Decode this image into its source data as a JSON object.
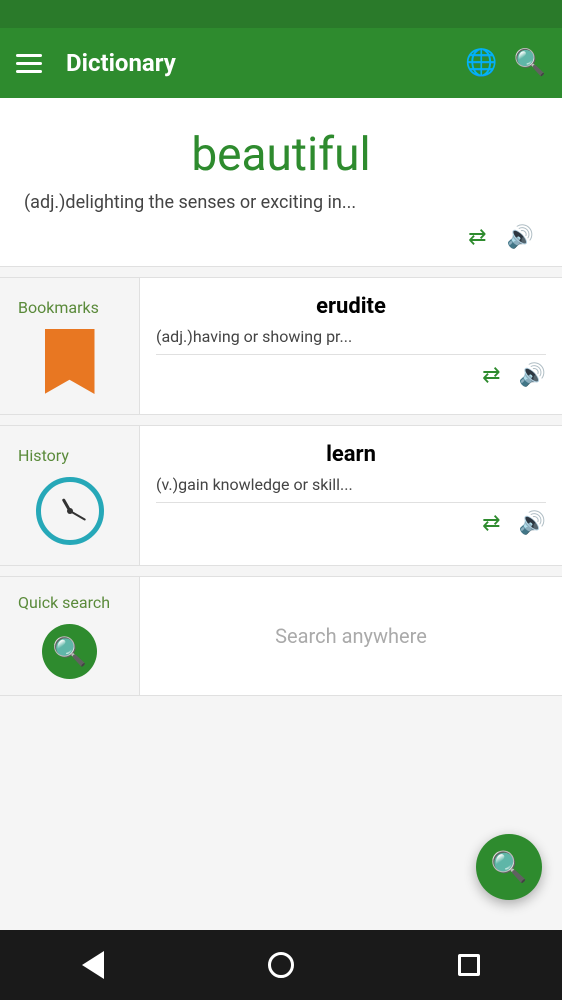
{
  "statusBar": {},
  "toolbar": {
    "title": "Dictionary",
    "menuIcon": "menu-icon",
    "globeIcon": "🌐",
    "searchIcon": "🔍"
  },
  "mainWord": {
    "word": "beautiful",
    "definition": "(adj.)delighting the senses or exciting in..."
  },
  "bookmarksCard": {
    "label": "Bookmarks",
    "word": "erudite",
    "definition": "(adj.)having or showing pr..."
  },
  "historyCard": {
    "label": "History",
    "word": "learn",
    "definition": "(v.)gain knowledge or skill..."
  },
  "quickSearchCard": {
    "label": "Quick search",
    "placeholder": "Search anywhere"
  },
  "fab": {
    "icon": "search"
  },
  "bottomNav": {
    "back": "back",
    "home": "home",
    "recents": "recents"
  }
}
